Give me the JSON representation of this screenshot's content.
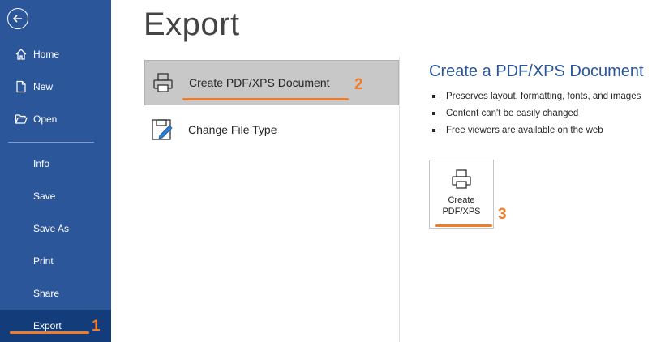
{
  "sidebar": {
    "items": [
      {
        "label": "Home",
        "icon": "home-icon"
      },
      {
        "label": "New",
        "icon": "new-document-icon"
      },
      {
        "label": "Open",
        "icon": "folder-open-icon"
      },
      {
        "label": "Info"
      },
      {
        "label": "Save"
      },
      {
        "label": "Save As"
      },
      {
        "label": "Print"
      },
      {
        "label": "Share"
      },
      {
        "label": "Export"
      }
    ],
    "active": "Export"
  },
  "main": {
    "title": "Export",
    "options": [
      {
        "label": "Create PDF/XPS Document",
        "icon": "pdf-xps-icon",
        "selected": true
      },
      {
        "label": "Change File Type",
        "icon": "change-file-type-icon",
        "selected": false
      }
    ]
  },
  "detail": {
    "title": "Create a PDF/XPS Document",
    "bullets": [
      "Preserves layout, formatting, fonts, and images",
      "Content can't be easily changed",
      "Free viewers are available on the web"
    ],
    "button_line1": "Create",
    "button_line2": "PDF/XPS"
  },
  "annotations": {
    "step1": "1",
    "step2": "2",
    "step3": "3",
    "color": "#f07c2a"
  },
  "colors": {
    "sidebar": "#2b579a",
    "sidebar_active": "#123c7a",
    "accent_title": "#2b579a"
  }
}
